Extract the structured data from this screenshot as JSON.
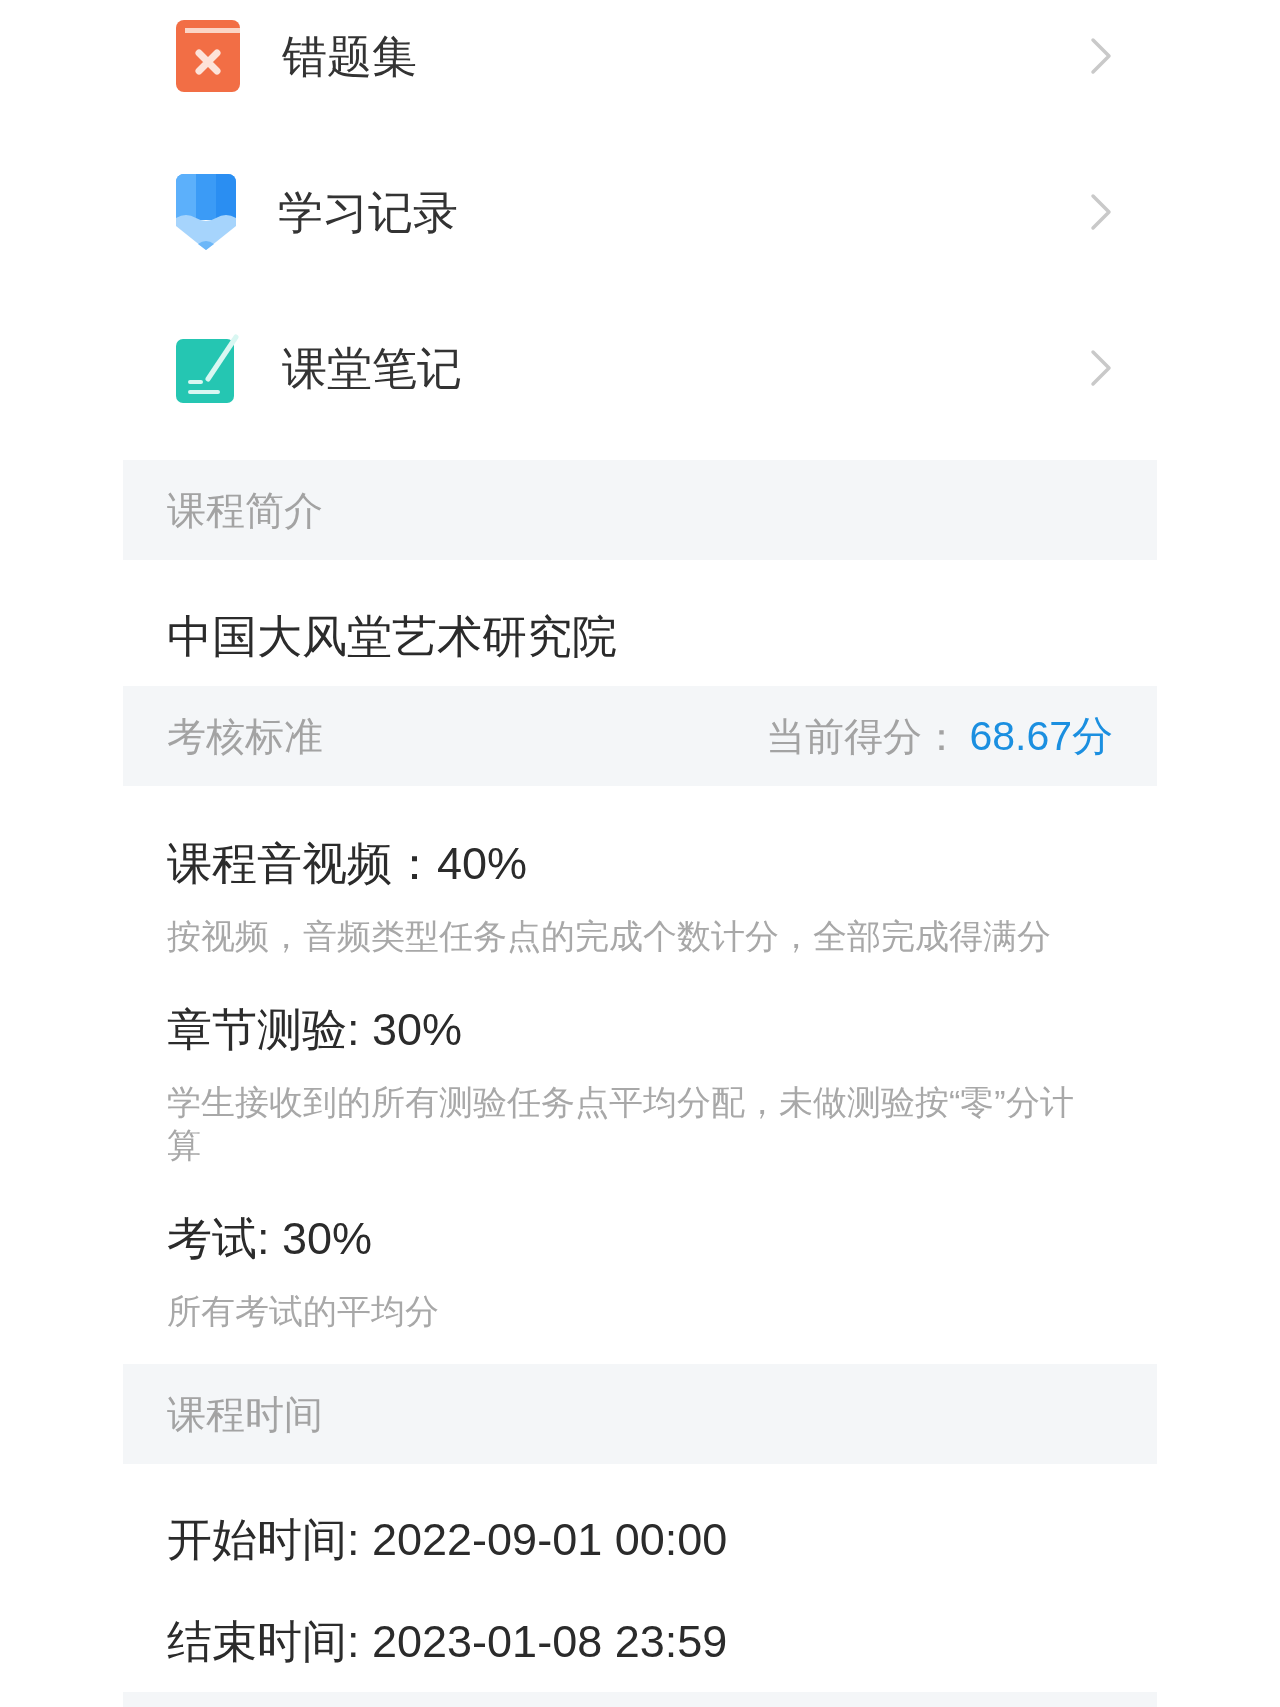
{
  "menu": [
    {
      "label": "错题集"
    },
    {
      "label": "学习记录"
    },
    {
      "label": "课堂笔记"
    }
  ],
  "course_intro": {
    "header": "课程简介",
    "text": "中国大风堂艺术研究院"
  },
  "assessment": {
    "header": "考核标准",
    "score_label": "当前得分：",
    "score_value": "68.67分",
    "criteria": [
      {
        "title": "课程音视频：40%",
        "description": "按视频，音频类型任务点的完成个数计分，全部完成得满分"
      },
      {
        "title": "章节测验: 30%",
        "description": "学生接收到的所有测验任务点平均分配，未做测验按“零”分计算"
      },
      {
        "title": "考试: 30%",
        "description": "所有考试的平均分"
      }
    ]
  },
  "course_time": {
    "header": "课程时间",
    "start": "开始时间: 2022-09-01 00:00",
    "end": "结束时间: 2023-01-08 23:59"
  }
}
